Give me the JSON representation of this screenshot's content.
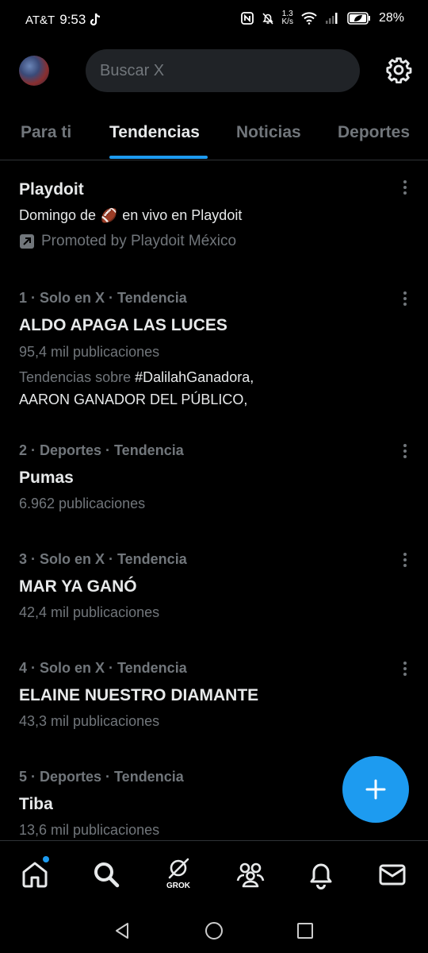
{
  "status_bar": {
    "carrier": "AT&T",
    "time": "9:53",
    "speed_top": "1.3",
    "speed_bottom": "K/s",
    "battery": "28%"
  },
  "header": {
    "search_placeholder": "Buscar X"
  },
  "tabs": [
    {
      "label": "Para ti",
      "active": false
    },
    {
      "label": "Tendencias",
      "active": true
    },
    {
      "label": "Noticias",
      "active": false
    },
    {
      "label": "Deportes",
      "active": false
    }
  ],
  "promoted": {
    "title": "Playdoit",
    "subtitle_before": "Domingo de",
    "emoji": "🏈",
    "subtitle_after": "en vivo en Playdoit",
    "promo_text": "Promoted by Playdoit México"
  },
  "trends": [
    {
      "meta": "1 · Solo en X · Tendencia",
      "title": "ALDO APAGA LAS LUCES",
      "count": "95,4 mil publicaciones",
      "related_prefix": "Tendencias sobre",
      "related_tag": "#DalilahGanadora,",
      "related_line2": "AARON GANADOR DEL PÚBLICO,"
    },
    {
      "meta": "2 · Deportes · Tendencia",
      "title": "Pumas",
      "count": "6.962 publicaciones"
    },
    {
      "meta": "3 · Solo en X · Tendencia",
      "title": "MAR YA GANÓ",
      "count": "42,4 mil publicaciones"
    },
    {
      "meta": "4 · Solo en X · Tendencia",
      "title": "ELAINE NUESTRO DIAMANTE",
      "count": "43,3 mil publicaciones"
    },
    {
      "meta": "5 · Deportes · Tendencia",
      "title": "Tiba",
      "count": "13,6 mil publicaciones"
    }
  ],
  "bottom_nav": {
    "grok_label": "GROK"
  },
  "colors": {
    "accent": "#1d9bf0",
    "background": "#000000",
    "text": "#e7e9ea",
    "muted": "#71767b"
  }
}
